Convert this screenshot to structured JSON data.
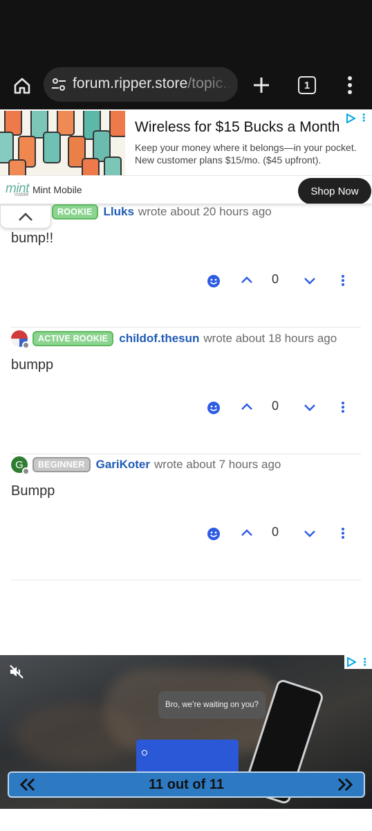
{
  "browser": {
    "url_host": "forum.ripper.store",
    "url_path": "/topic...",
    "tab_count": "1"
  },
  "top_ad": {
    "headline": "Wireless for $15 Bucks a Month",
    "copy_line1": "Keep your money where it belongs—in your pocket.",
    "copy_line2": "New customer plans $15/mo. ($45 upfront).",
    "logo_text": "mint",
    "logo_sub": "mobile",
    "brand_name": "Mint Mobile",
    "cta_label": "Shop Now"
  },
  "posts": [
    {
      "badge": "ROOKIE",
      "username": "Lluks",
      "when": "wrote about 20 hours ago",
      "body": "bump!!",
      "votes": "0"
    },
    {
      "badge": "ACTIVE ROOKIE",
      "username": "childof.thesun",
      "when": "wrote about 18 hours ago",
      "body": "bumpp",
      "votes": "0"
    },
    {
      "badge": "BEGINNER",
      "username": "GariKoter",
      "when": "wrote about 7 hours ago",
      "body": "Bumpp",
      "votes": "0",
      "avatar_letter": "G"
    }
  ],
  "video_ad": {
    "bubble_text": "Bro, we’re waiting on you?",
    "pager_label": "11 out of 11"
  },
  "colors": {
    "link_blue": "#1f5bb5",
    "action_blue": "#2d5be3",
    "badge_green": "#8cd490",
    "badge_grey": "#c7c7c7"
  }
}
